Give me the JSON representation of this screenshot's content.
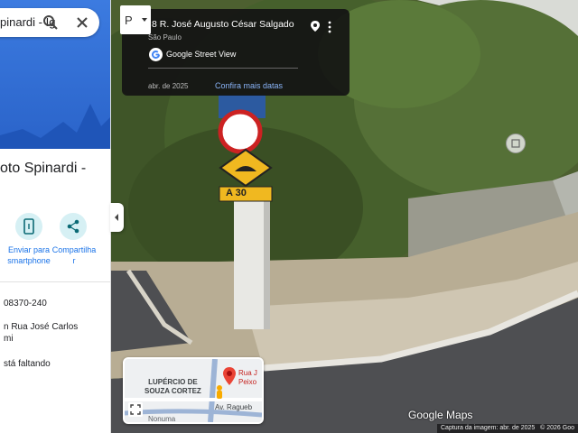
{
  "search": {
    "value": "pinardi - Ig",
    "search_icon": "search-icon",
    "close_icon": "close-icon"
  },
  "place": {
    "title_line1": "oto Spinardi -",
    "title_line2": ""
  },
  "actions": [
    {
      "label_line1": "Enviar para",
      "label_line2": "smartphone",
      "icon": "phone-icon"
    },
    {
      "label_line1": "Compartilha",
      "label_line2": "r",
      "icon": "share-icon"
    }
  ],
  "info": {
    "cep": "08370-240",
    "address_line1": "n Rua José Carlos",
    "address_line2": "mi",
    "missing": "stá faltando"
  },
  "streetview": {
    "title": "8 R. José Augusto César Salgado",
    "subtitle": "São Paulo",
    "brand": "Google Street View",
    "date": "abr. de 2025",
    "more_link": "Confira mais datas"
  },
  "minimap": {
    "label_left": "LUPÉRCIO DE\nSOUZA CORTEZ",
    "label_pin": "Rua J\nPeixo",
    "label_road": "Av. Ragueb",
    "label_bottom": "Nonuma"
  },
  "scene_sign": {
    "speed_text": "A 30"
  },
  "logo": {
    "google": "Google",
    "maps": "Maps"
  },
  "footer": {
    "capture": "Captura da imagem: abr. de 2025",
    "copyright": "© 2026 Goo"
  },
  "colors": {
    "accent": "#1a73e8",
    "hero": "#2f6fd8",
    "pin": "#ea4335"
  }
}
